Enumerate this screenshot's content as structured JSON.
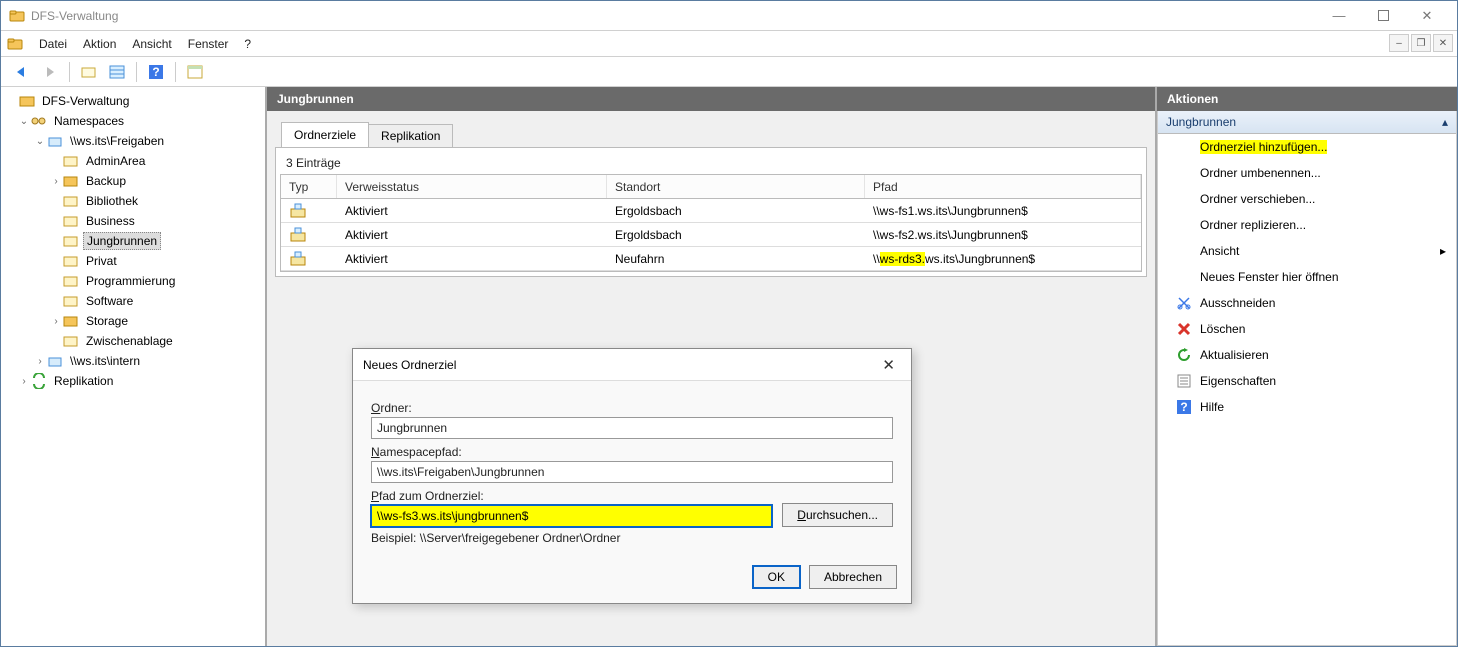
{
  "window": {
    "title": "DFS-Verwaltung"
  },
  "menubar": {
    "datei": "Datei",
    "aktion": "Aktion",
    "ansicht": "Ansicht",
    "fenster": "Fenster",
    "help": "?"
  },
  "tree": {
    "root": "DFS-Verwaltung",
    "namespaces": "Namespaces",
    "ns_freigaben": "\\\\ws.its\\Freigaben",
    "items": {
      "adminarea": "AdminArea",
      "backup": "Backup",
      "bibliothek": "Bibliothek",
      "business": "Business",
      "jungbrunnen": "Jungbrunnen",
      "privat": "Privat",
      "programmierung": "Programmierung",
      "software": "Software",
      "storage": "Storage",
      "zwischenablage": "Zwischenablage"
    },
    "ns_intern": "\\\\ws.its\\intern",
    "replikation": "Replikation"
  },
  "center": {
    "title": "Jungbrunnen",
    "tabs": {
      "ordnerziele": "Ordnerziele",
      "replikation": "Replikation"
    },
    "entrycount": "3 Einträge",
    "columns": {
      "typ": "Typ",
      "verweis": "Verweisstatus",
      "standort": "Standort",
      "pfad": "Pfad"
    },
    "rows": [
      {
        "status": "Aktiviert",
        "loc": "Ergoldsbach",
        "path_pre": "\\\\ws-fs1.ws.its\\Jungbrunnen$",
        "hl": ""
      },
      {
        "status": "Aktiviert",
        "loc": "Ergoldsbach",
        "path_pre": "\\\\ws-fs2.ws.its\\Jungbrunnen$",
        "hl": ""
      },
      {
        "status": "Aktiviert",
        "loc": "Neufahrn",
        "path_pre": "\\\\",
        "hl": "ws-rds3.",
        "path_post": "ws.its\\Jungbrunnen$"
      }
    ]
  },
  "dialog": {
    "title": "Neues Ordnerziel",
    "ordner_label": "Ordner:",
    "ordner_value": "Jungbrunnen",
    "nspath_label": "Namespacepfad:",
    "nspath_value": "\\\\ws.its\\Freigaben\\Jungbrunnen",
    "target_label": "Pfad zum Ordnerziel:",
    "target_value": "\\\\ws-fs3.ws.its\\jungbrunnen$",
    "browse": "Durchsuchen...",
    "hint": "Beispiel: \\\\Server\\freigegebener Ordner\\Ordner",
    "ok": "OK",
    "cancel": "Abbrechen"
  },
  "actions": {
    "header": "Aktionen",
    "section": "Jungbrunnen",
    "items": {
      "add_target": "Ordnerziel hinzufügen...",
      "rename": "Ordner umbenennen...",
      "move": "Ordner verschieben...",
      "replicate": "Ordner replizieren...",
      "view": "Ansicht",
      "new_window": "Neues Fenster hier öffnen",
      "cut": "Ausschneiden",
      "delete": "Löschen",
      "refresh": "Aktualisieren",
      "properties": "Eigenschaften",
      "help": "Hilfe"
    }
  }
}
